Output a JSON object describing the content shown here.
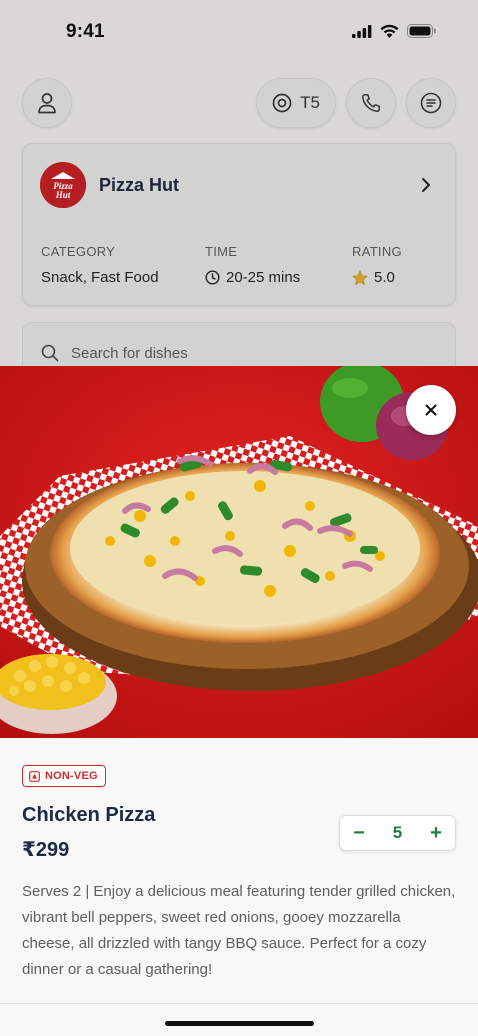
{
  "status_bar": {
    "time": "9:41",
    "icons": [
      "signal-icon",
      "wifi-icon",
      "battery-icon"
    ]
  },
  "topbar": {
    "table_label": "T5"
  },
  "restaurant": {
    "name": "Pizza Hut",
    "logo_text": "Pizza Hut",
    "category_label": "CATEGORY",
    "category_value": "Snack, Fast Food",
    "time_label": "TIME",
    "time_value": "20-25 mins",
    "rating_label": "RATING",
    "rating_value": "5.0"
  },
  "search": {
    "placeholder": "Search for dishes"
  },
  "dish": {
    "badge": "NON-VEG",
    "name": "Chicken Pizza",
    "price": "₹299",
    "quantity": "5",
    "minus": "−",
    "plus": "+",
    "description": "Serves 2 | Enjoy a delicious meal featuring tender grilled chicken, vibrant bell peppers, sweet red onions, gooey mozzarella cheese, all drizzled with tangy BBQ sauce. Perfect for a cozy dinner or a casual gathering!"
  },
  "colors": {
    "accent_green": "#1c7f3a",
    "nonveg_red": "#d22b2b",
    "brand_red": "#b51f23",
    "text_dark": "#1c2a47"
  }
}
